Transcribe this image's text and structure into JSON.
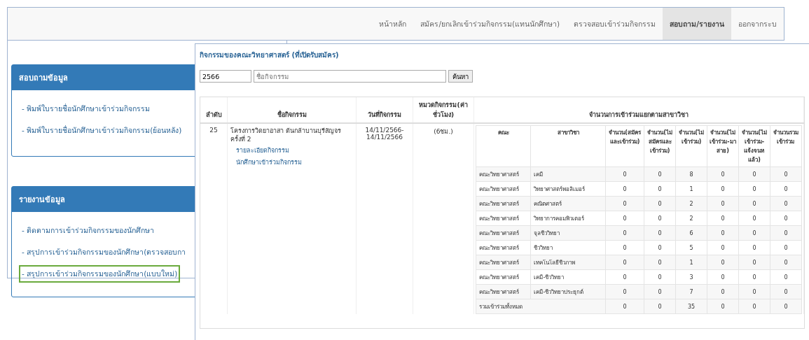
{
  "navbar": {
    "items": [
      {
        "label": "หน้าหลัก",
        "selected": false
      },
      {
        "label": "สมัคร/ยกเลิกเข้าร่วมกิจกรรม(แทนนักศึกษา)",
        "selected": false
      },
      {
        "label": "ตรวจสอบเข้าร่วมกิจกรรม",
        "selected": false
      },
      {
        "label": "สอบถาม/รายงาน",
        "selected": true
      },
      {
        "label": "ออกจากระบ",
        "selected": false
      }
    ]
  },
  "sidebar": {
    "panels": [
      {
        "title": "สอบถามข้อมูล",
        "links": [
          {
            "label": "- พิมพ์ใบรายชื่อนักศึกษาเข้าร่วมกิจกรรม",
            "highlighted": false
          },
          {
            "label": "- พิมพ์ใบรายชื่อนักศึกษาเข้าร่วมกิจกรรม(ย้อนหลัง)",
            "highlighted": false
          }
        ]
      },
      {
        "title": "รายงานข้อมูล",
        "links": [
          {
            "label": "- ติดตามการเข้าร่วมกิจกรรมของนักศึกษา",
            "highlighted": false
          },
          {
            "label": "- สรุปการเข้าร่วมกิจกรรมของนักศึกษา(ตรวจสอบกา",
            "highlighted": false
          },
          {
            "label": "- สรุปการเข้าร่วมกิจกรรมของนักศึกษา(แบบใหม่)",
            "highlighted": true
          }
        ]
      }
    ]
  },
  "popup": {
    "title": "กิจกรรมของคณะวิทยาศาสตร์ (ที่เปิดรับสมัคร)",
    "search": {
      "year": "2566",
      "placeholder": "ชื่อกิจกรรม",
      "button": "ค้นหา"
    },
    "table": {
      "columns": [
        "ลำดับ",
        "ชื่อกิจกรรม",
        "วันที่กิจกรรม",
        "หมวดกิจกรรม(ค่าชั่วโมง)",
        "จำนวนการเข้าร่วมแยกตามสาขาวิชา"
      ],
      "rows": [
        {
          "number": "25",
          "name": "โครงการวิดยาอาสา ต้นกล้าบานบุรีสัญจร ครั้งที่ 2",
          "links": [
            "รายละเอียดกิจกรรม",
            "นักศึกษาเข้าร่วมกิจกรรม"
          ],
          "date": "14/11/2566-14/11/2566",
          "category": "(6ชม.)",
          "breakdown": {
            "columns": [
              "คณะ",
              "สาขาวิชา",
              "จำนวน(สมัครและเข้าร่วม)",
              "จำนวน(ไม่สมัครและเข้าร่วม)",
              "จำนวน(ไม่เข้าร่วม)",
              "จำนวน(ไม่เข้าร่วม-มาสาย)",
              "จำนวน(ไม่เข้าร่วม-แจ้งจนหแล้ว)",
              "จำนวนรวมเข้าร่วม"
            ],
            "rows": [
              {
                "faculty": "คณะวิทยาศาสตร์",
                "major": "เคมี",
                "values": [
                  "0",
                  "0",
                  "8",
                  "0",
                  "0",
                  "0"
                ]
              },
              {
                "faculty": "คณะวิทยาศาสตร์",
                "major": "วิทยาศาสตร์พอลิเมอร์",
                "values": [
                  "0",
                  "0",
                  "1",
                  "0",
                  "0",
                  "0"
                ]
              },
              {
                "faculty": "คณะวิทยาศาสตร์",
                "major": "คณิตศาสตร์",
                "values": [
                  "0",
                  "0",
                  "2",
                  "0",
                  "0",
                  "0"
                ]
              },
              {
                "faculty": "คณะวิทยาศาสตร์",
                "major": "วิทยาการคอมพิวเตอร์",
                "values": [
                  "0",
                  "0",
                  "2",
                  "0",
                  "0",
                  "0"
                ]
              },
              {
                "faculty": "คณะวิทยาศาสตร์",
                "major": "จุลชีววิทยา",
                "values": [
                  "0",
                  "0",
                  "6",
                  "0",
                  "0",
                  "0"
                ]
              },
              {
                "faculty": "คณะวิทยาศาสตร์",
                "major": "ชีววิทยา",
                "values": [
                  "0",
                  "0",
                  "5",
                  "0",
                  "0",
                  "0"
                ]
              },
              {
                "faculty": "คณะวิทยาศาสตร์",
                "major": "เทคโนโลยีชีวภาพ",
                "values": [
                  "0",
                  "0",
                  "1",
                  "0",
                  "0",
                  "0"
                ]
              },
              {
                "faculty": "คณะวิทยาศาสตร์",
                "major": "เคมี-ชีววิทยา",
                "values": [
                  "0",
                  "0",
                  "3",
                  "0",
                  "0",
                  "0"
                ]
              },
              {
                "faculty": "คณะวิทยาศาสตร์",
                "major": "เคมี-ชีววิทยาประยุกต์",
                "values": [
                  "0",
                  "0",
                  "7",
                  "0",
                  "0",
                  "0"
                ]
              }
            ],
            "total": {
              "label": "รวมเข้าร่วมทั้งหมด",
              "values": [
                "0",
                "0",
                "35",
                "0",
                "0",
                "0"
              ]
            }
          }
        }
      ]
    }
  }
}
